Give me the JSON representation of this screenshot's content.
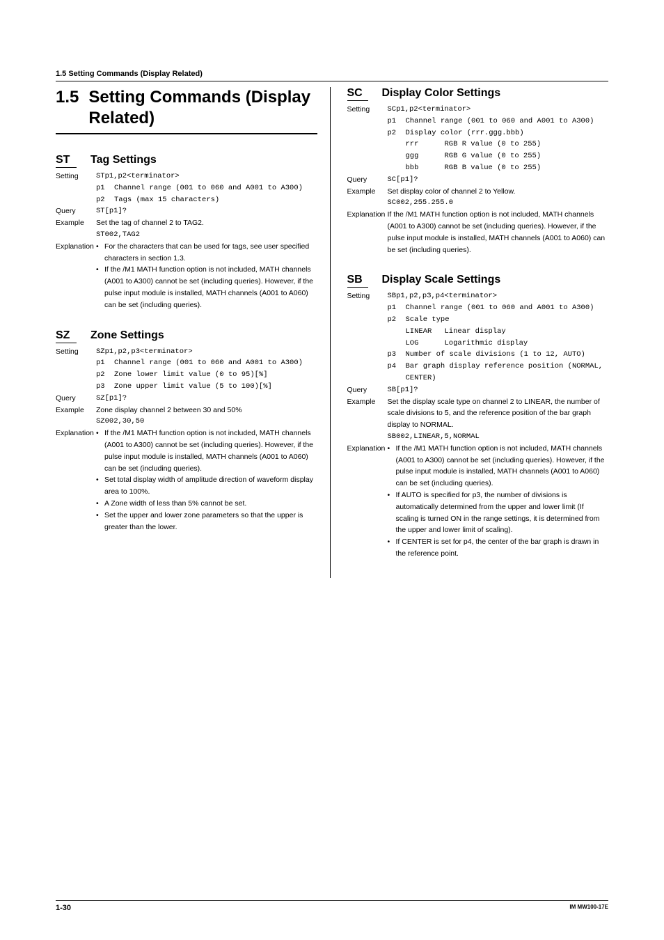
{
  "running_header": "1.5  Setting Commands (Display Related)",
  "main": {
    "num": "1.5",
    "title": "Setting Commands (Display Related)"
  },
  "st": {
    "code": "ST",
    "name": "Tag Settings",
    "setting_label": "Setting",
    "syntax": "STp1,p2<terminator>",
    "p1k": "p1",
    "p1v": "Channel range (001 to 060 and A001 to A300)",
    "p2k": "p2",
    "p2v": "Tags (max 15 characters)",
    "query_label": "Query",
    "query": "ST[p1]?",
    "example_label": "Example",
    "example_text": "Set the tag of channel 2 to TAG2.",
    "example_code": "ST002,TAG2",
    "expl_label": "Explanation",
    "b1": "For the characters that can be used for tags, see user specified characters in section 1.3.",
    "b2": "If the /M1 MATH function option is not included, MATH channels (A001 to A300) cannot be set (including queries). However, if the pulse input module is installed, MATH channels (A001 to A060) can be set (including queries)."
  },
  "sz": {
    "code": "SZ",
    "name": "Zone Settings",
    "setting_label": "Setting",
    "syntax": "SZp1,p2,p3<terminator>",
    "p1k": "p1",
    "p1v": "Channel range (001 to 060 and A001 to A300)",
    "p2k": "p2",
    "p2v": "Zone lower limit value (0 to 95)[%]",
    "p3k": "p3",
    "p3v": "Zone upper limit value (5 to 100)[%]",
    "query_label": "Query",
    "query": "SZ[p1]?",
    "example_label": "Example",
    "example_text": "Zone display channel 2 between 30 and 50%",
    "example_code": "SZ002,30,50",
    "expl_label": "Explanation",
    "b1": "If the /M1 MATH function option is not included, MATH channels (A001 to A300) cannot be set (including queries). However, if the pulse input module is installed, MATH channels (A001 to A060) can be set (including queries).",
    "b2": "Set total display width of amplitude direction of waveform display area to 100%.",
    "b3": "A Zone width of less than 5% cannot be set.",
    "b4": "Set the upper and lower zone parameters so that the upper is greater than the lower."
  },
  "sc": {
    "code": "SC",
    "name": "Display Color Settings",
    "setting_label": "Setting",
    "syntax": "SCp1,p2<terminator>",
    "p1k": "p1",
    "p1v": "Channel range (001 to 060 and A001 to A300)",
    "p2k": "p2",
    "p2v": "Display color (rrr.ggg.bbb)",
    "s1k": "rrr",
    "s1v": "RGB R value (0 to 255)",
    "s2k": "ggg",
    "s2v": "RGB G value (0 to 255)",
    "s3k": "bbb",
    "s3v": "RGB B value (0 to 255)",
    "query_label": "Query",
    "query": "SC[p1]?",
    "example_label": "Example",
    "example_text": "Set display color of channel 2 to Yellow.",
    "example_code": "SC002,255.255.0",
    "expl_label": "Explanation",
    "expl_text": "If the /M1 MATH function option is not included, MATH channels (A001 to A300) cannot be set (including queries). However, if the pulse input module is installed, MATH channels (A001 to A060) can be set (including queries)."
  },
  "sb": {
    "code": "SB",
    "name": "Display Scale Settings",
    "setting_label": "Setting",
    "syntax": "SBp1,p2,p3,p4<terminator>",
    "p1k": "p1",
    "p1v": "Channel range (001 to 060 and A001 to A300)",
    "p2k": "p2",
    "p2v": "Scale type",
    "s1k": "LINEAR",
    "s1v": "Linear display",
    "s2k": "LOG",
    "s2v": "Logarithmic display",
    "p3k": "p3",
    "p3v": "Number of scale divisions (1 to 12, AUTO)",
    "p4k": "p4",
    "p4v": "Bar graph display reference position (NORMAL, CENTER)",
    "query_label": "Query",
    "query": "SB[p1]?",
    "example_label": "Example",
    "example_text": "Set the display scale type on channel 2 to LINEAR, the number of scale divisions to 5, and the reference position of the bar graph display to NORMAL.",
    "example_code": "SB002,LINEAR,5,NORMAL",
    "expl_label": "Explanation",
    "b1": "If the /M1 MATH function option is not included, MATH channels (A001 to A300) cannot be set (including queries). However, if the pulse input module is installed, MATH channels (A001 to A060) can be set (including queries).",
    "b2": "If AUTO is specified for p3, the number of divisions is automatically determined from the upper and lower limit (If scaling is turned ON in the range settings, it is determined from the upper and lower limit of scaling).",
    "b3": "If CENTER is set for p4, the center of the bar graph is drawn in the reference point."
  },
  "footer": {
    "page": "1-30",
    "doc": "IM MW100-17E"
  }
}
